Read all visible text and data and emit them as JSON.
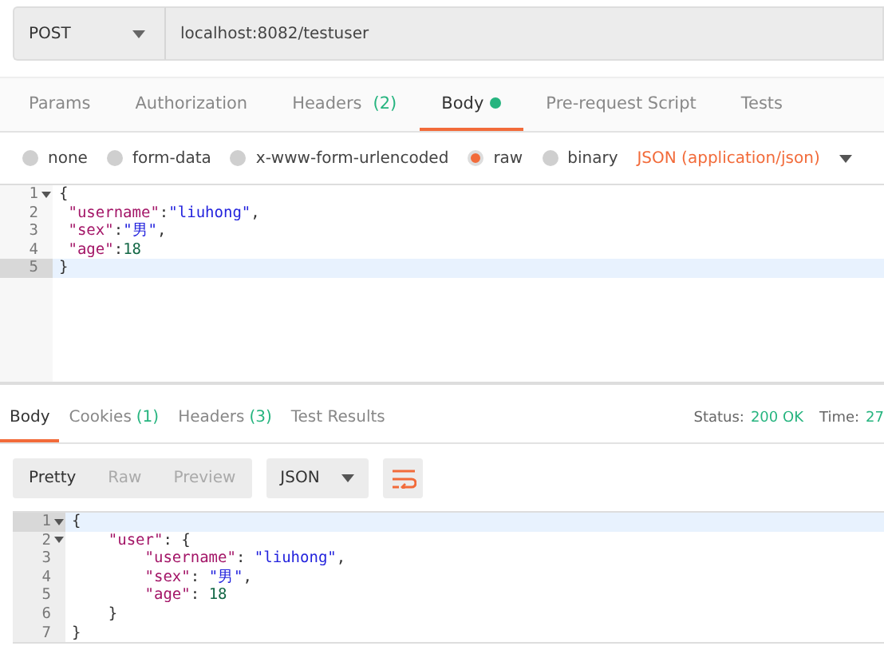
{
  "request": {
    "method": "POST",
    "url": "localhost:8082/testuser"
  },
  "tabs": [
    {
      "label": "Params",
      "selected": false
    },
    {
      "label": "Authorization",
      "selected": false
    },
    {
      "label": "Headers",
      "count": "(2)",
      "selected": false
    },
    {
      "label": "Body",
      "dot": true,
      "selected": true
    },
    {
      "label": "Pre-request Script",
      "selected": false
    },
    {
      "label": "Tests",
      "selected": false
    }
  ],
  "body_types": [
    {
      "label": "none",
      "selected": false
    },
    {
      "label": "form-data",
      "selected": false
    },
    {
      "label": "x-www-form-urlencoded",
      "selected": false
    },
    {
      "label": "raw",
      "selected": true
    },
    {
      "label": "binary",
      "selected": false
    }
  ],
  "content_type": "JSON (application/json)",
  "request_editor": [
    {
      "number": "1",
      "foldable": true,
      "selected": false,
      "tokens": [
        {
          "kind": "punct",
          "text": "{"
        }
      ]
    },
    {
      "number": "2",
      "foldable": false,
      "selected": false,
      "tokens": [
        {
          "kind": "key",
          "text": " \"username\""
        },
        {
          "kind": "punct",
          "text": ":"
        },
        {
          "kind": "string",
          "text": "\"liuhong\""
        },
        {
          "kind": "punct",
          "text": ","
        }
      ]
    },
    {
      "number": "3",
      "foldable": false,
      "selected": false,
      "tokens": [
        {
          "kind": "key",
          "text": " \"sex\""
        },
        {
          "kind": "punct",
          "text": ":"
        },
        {
          "kind": "string",
          "text": "\"男\""
        },
        {
          "kind": "punct",
          "text": ","
        }
      ]
    },
    {
      "number": "4",
      "foldable": false,
      "selected": false,
      "tokens": [
        {
          "kind": "key",
          "text": " \"age\""
        },
        {
          "kind": "punct",
          "text": ":"
        },
        {
          "kind": "number",
          "text": "18"
        }
      ]
    },
    {
      "number": "5",
      "foldable": false,
      "selected": true,
      "tokens": [
        {
          "kind": "punct",
          "text": "}"
        }
      ]
    }
  ],
  "response_tabs": [
    {
      "label": "Body",
      "selected": true
    },
    {
      "label": "Cookies",
      "count": "(1)",
      "selected": false
    },
    {
      "label": "Headers",
      "count": "(3)",
      "selected": false
    },
    {
      "label": "Test Results",
      "selected": false
    }
  ],
  "status": {
    "label": "Status:",
    "value": "200 OK"
  },
  "time": {
    "label": "Time:",
    "value": "27"
  },
  "view_modes": [
    {
      "label": "Pretty",
      "selected": true
    },
    {
      "label": "Raw",
      "selected": false
    },
    {
      "label": "Preview",
      "selected": false
    }
  ],
  "format": "JSON",
  "response_editor": [
    {
      "number": "1",
      "foldable": true,
      "selected": true,
      "tokens": [
        {
          "kind": "punct",
          "text": "{"
        }
      ]
    },
    {
      "number": "2",
      "foldable": true,
      "selected": false,
      "tokens": [
        {
          "kind": "key",
          "text": "    \"user\""
        },
        {
          "kind": "punct",
          "text": ": {"
        }
      ]
    },
    {
      "number": "3",
      "foldable": false,
      "selected": false,
      "tokens": [
        {
          "kind": "key",
          "text": "        \"username\""
        },
        {
          "kind": "punct",
          "text": ": "
        },
        {
          "kind": "string",
          "text": "\"liuhong\""
        },
        {
          "kind": "punct",
          "text": ","
        }
      ]
    },
    {
      "number": "4",
      "foldable": false,
      "selected": false,
      "tokens": [
        {
          "kind": "key",
          "text": "        \"sex\""
        },
        {
          "kind": "punct",
          "text": ": "
        },
        {
          "kind": "string",
          "text": "\"男\""
        },
        {
          "kind": "punct",
          "text": ","
        }
      ]
    },
    {
      "number": "5",
      "foldable": false,
      "selected": false,
      "tokens": [
        {
          "kind": "key",
          "text": "        \"age\""
        },
        {
          "kind": "punct",
          "text": ": "
        },
        {
          "kind": "number",
          "text": "18"
        }
      ]
    },
    {
      "number": "6",
      "foldable": false,
      "selected": false,
      "tokens": [
        {
          "kind": "punct",
          "text": "    }"
        }
      ]
    },
    {
      "number": "7",
      "foldable": false,
      "selected": false,
      "tokens": [
        {
          "kind": "punct",
          "text": "}"
        }
      ]
    }
  ]
}
